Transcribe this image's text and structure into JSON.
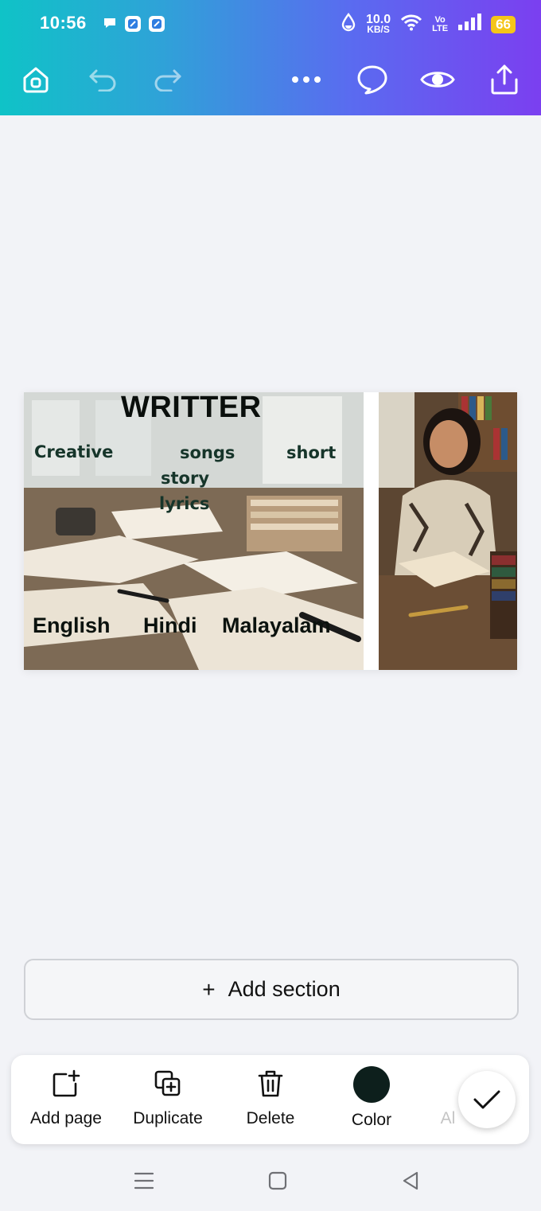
{
  "status_bar": {
    "time": "10:56",
    "net_speed_value": "10.0",
    "net_speed_unit": "KB/S",
    "volte_top": "Vo",
    "volte_bottom": "LTE",
    "battery": "66",
    "icons": [
      "chat-bubble-icon",
      "app-icon",
      "app-icon",
      "water-drop-icon",
      "wifi-icon",
      "signal-icon",
      "battery-icon"
    ]
  },
  "toolbar": {
    "icons": [
      "home-icon",
      "undo-icon",
      "redo-icon",
      "more-icon",
      "comment-icon",
      "preview-eye-icon",
      "share-icon"
    ],
    "accent_gradient": [
      "#0fc3c7",
      "#7b3ff0"
    ]
  },
  "design": {
    "title": "WRITTER",
    "tags": {
      "creative": "Creative",
      "songs": "songs",
      "short": "short",
      "story": "story",
      "lyrics": "lyrics"
    },
    "languages": {
      "english": "English",
      "hindi": "Hindi",
      "malayalam": "Malayalam"
    }
  },
  "add_section": {
    "plus": "+",
    "label": "Add section"
  },
  "page_actions": {
    "add_page": "Add page",
    "duplicate": "Duplicate",
    "delete": "Delete",
    "color": "Color",
    "truncated": "Al",
    "color_swatch": "#0d1f1c"
  }
}
